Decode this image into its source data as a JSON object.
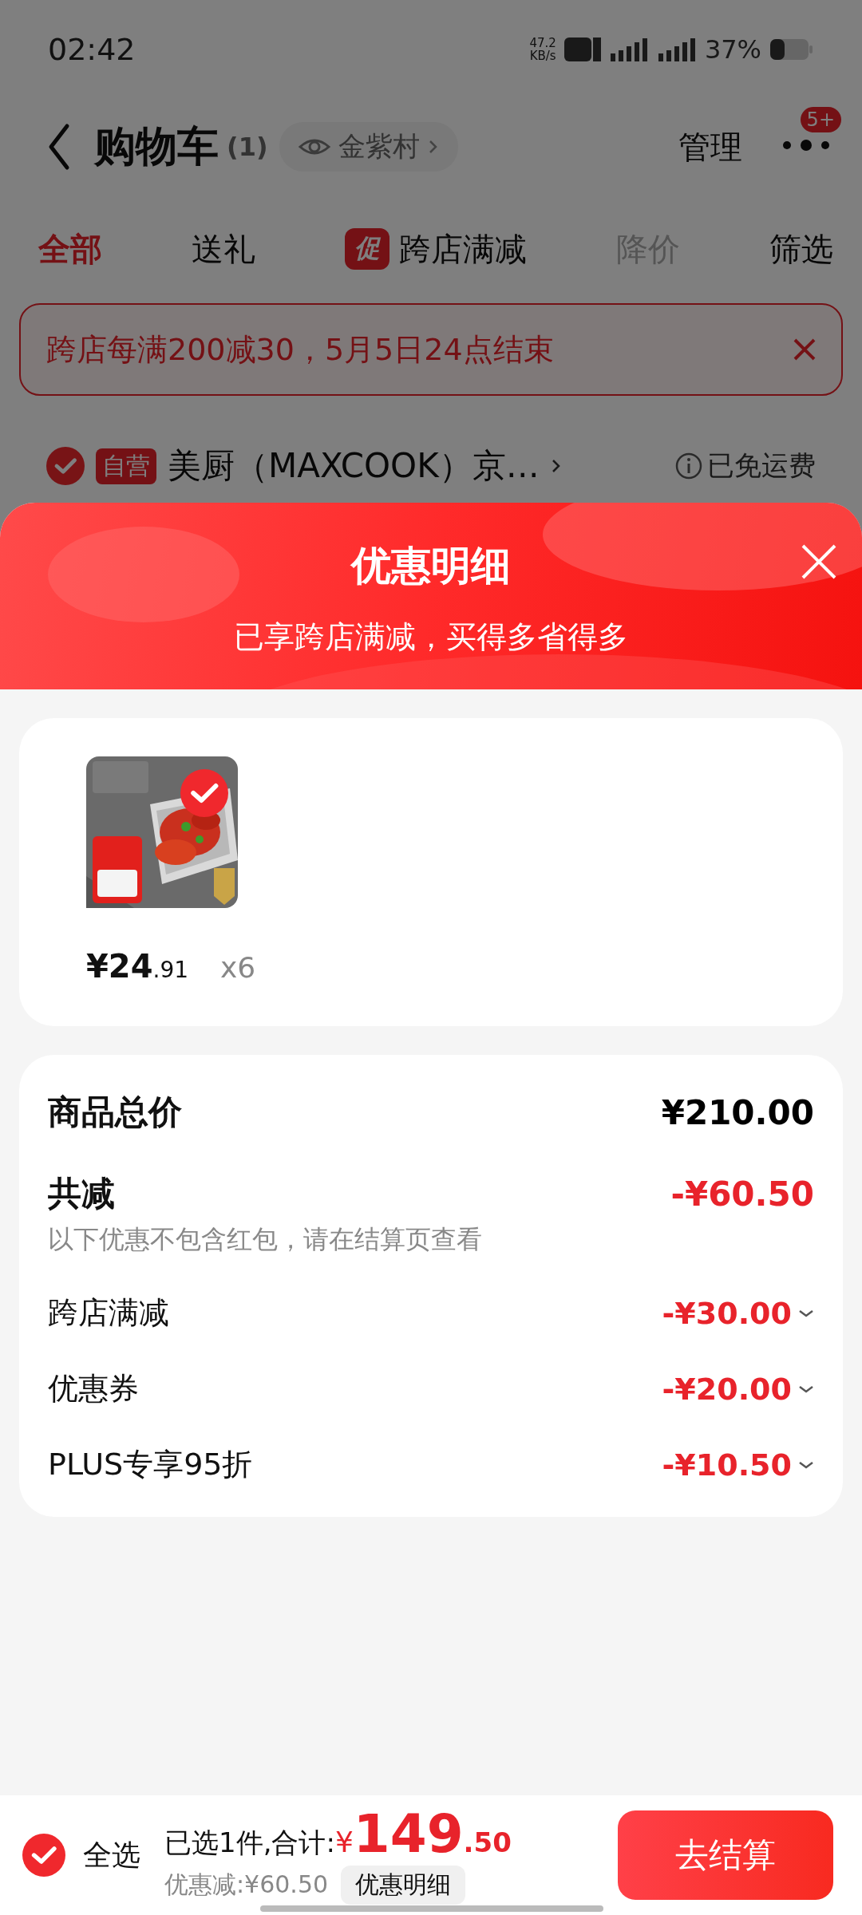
{
  "status_bar": {
    "time": "02:42",
    "net_speed": "47.2",
    "net_unit": "KB/s",
    "battery": "37%"
  },
  "header": {
    "title": "购物车",
    "count": "(1)",
    "location": "金紫村",
    "manage": "管理",
    "badge": "5+"
  },
  "tabs": [
    {
      "label": "全部",
      "selected": true,
      "disabled": false
    },
    {
      "label": "送礼",
      "selected": false,
      "disabled": false
    },
    {
      "label": "跨店满减",
      "selected": false,
      "disabled": false,
      "promo_tag": "促"
    },
    {
      "label": "降价",
      "selected": false,
      "disabled": true
    },
    {
      "label": "筛选",
      "selected": false,
      "disabled": false
    }
  ],
  "notice": {
    "text": "跨店每满200减30，5月5日24点结束"
  },
  "shop": {
    "checked": true,
    "tag": "自营",
    "name": "美厨（MAXCOOK）京…",
    "shipping": "已免运费"
  },
  "sheet": {
    "title": "优惠明细",
    "subtitle": "已享跨店满减，买得多省得多",
    "items": [
      {
        "kind": "picture",
        "checked": true,
        "price_main": "¥24",
        "price_decimal": ".91",
        "quantity": "x6"
      }
    ],
    "summary": {
      "total_label": "商品总价",
      "total": "¥210.00",
      "discount_label": "共减",
      "discount": "-¥60.50",
      "note": "以下优惠不包含红包，请在结算页查看",
      "lines": [
        {
          "label": "跨店满减",
          "amount": "-¥30.00"
        },
        {
          "label": "优惠券",
          "amount": "-¥20.00"
        },
        {
          "label": "PLUS专享95折",
          "amount": "-¥10.50"
        }
      ]
    }
  },
  "footer": {
    "select_all_checked": true,
    "select_all": "全选",
    "selected_text": "已选1件,合计:",
    "currency": "¥",
    "total_main": "149",
    "total_decimal": ".50",
    "saved": "优惠减:¥60.50",
    "detail_button": "优惠明细",
    "checkout": "去结算"
  }
}
